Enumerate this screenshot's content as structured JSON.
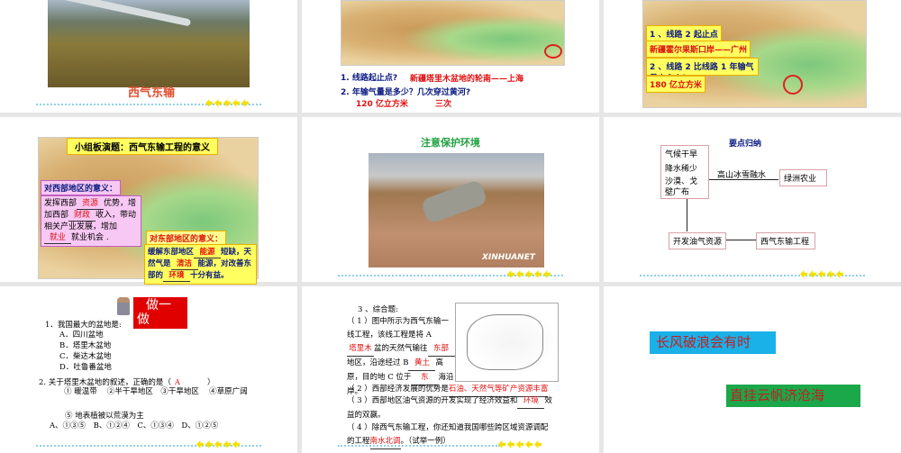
{
  "slide1": {
    "title": "西气东输"
  },
  "slide2": {
    "q1": "1. 线路起止点?",
    "a1": "新疆塔里木盆地的轮南——上海",
    "q2": "2.  年输气量是多少？几次穿过黄河?",
    "a2a": "120 亿立方米",
    "a2b": "三次"
  },
  "slide3": {
    "q1": "1 、线路 2 起止点",
    "a1": "新疆霍尔果斯口岸——广州",
    "q2": "2 、线路 2 比线路 1 年输气量大多少？",
    "a2": "180 亿立方米"
  },
  "slide4": {
    "title": "小组板演题：西气东输工程的意义",
    "west_title": "对西部地区的意义：",
    "west_text": [
      "发挥西部",
      "优势，增加西部",
      "收入，带动相关产业发展，增加",
      "就业机会 ."
    ],
    "west_answers": [
      "资源",
      "财政",
      "就业"
    ],
    "east_title": "对东部地区的意义：",
    "east_text": [
      "缓解东部地区",
      "短缺，天然气是",
      "能源，对改善东部的",
      "十分有益。"
    ],
    "east_answers": [
      "能源",
      "清洁",
      "环境"
    ]
  },
  "slide5": {
    "title": "注意保护环境",
    "watermark": "XINHUANET"
  },
  "slide6": {
    "title": "要点归纳",
    "box1": [
      "气候干旱",
      "降水稀少",
      "沙漠、戈壁广布"
    ],
    "arrow_label": "高山冰雪融水",
    "box2": "绿洲农业",
    "box3": "开发油气资源",
    "box4": "西气东输工程"
  },
  "slide7": {
    "badge": "做一做",
    "q1": "1．我国最大的盆地是:",
    "options1": [
      "A．四川盆地",
      "B．塔里木盆地",
      "C．柴达木盆地",
      "D．吐鲁番盆地"
    ],
    "q2": "2. 关于塔里木盆地的叙述，正确的是（",
    "q2_end": "）",
    "q2_answer": "A",
    "items": "① 暖温带　 ②半干旱地区　③干旱地区　 ④草原广阔",
    "item5": "⑤ 地表植被以荒漠为主",
    "options2": "A、①③⑤　B、①②④　C、①③④　D、①②⑤"
  },
  "slide8": {
    "title": "3 、综合题:",
    "l1": "（ 1 ）图中所示为西气东输一线工程，该线工程是将 A",
    "a1": "塔里木",
    "l1b": "盆的天然气输往",
    "a2": "东部",
    "l2b": "地区，沿途经过 B",
    "a3": "黄土",
    "l3b": "高原，目的地 C 位于",
    "a4": "东",
    "l4b": "海沿岸。",
    "l5": "（ 2 ）西部经济发展的优势是",
    "a5": "石油、天然气等矿产资源丰富",
    "l6": "（ 3 ）西部地区油气资源的开发实现了经济效益和",
    "a6": "环境",
    "l6b": "效益的双赢。",
    "l7": "（ 4 ）除西气东输工程，你还知道我国哪些跨区域资源调配的工程",
    "a7": "南水北调",
    "l7b": "。（试举一例）"
  },
  "slide9": {
    "line1": "长风破浪会有时",
    "line2": "直挂云帆济沧海"
  },
  "colors": {
    "answer": "#e01010",
    "navy": "#0a1a80",
    "cyan": "#1ab0e8",
    "green": "#1aa84a"
  }
}
